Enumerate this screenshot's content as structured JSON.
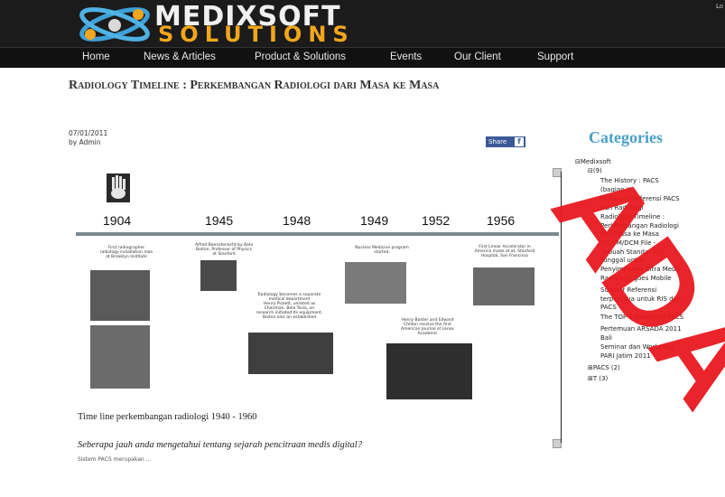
{
  "brand": {
    "name": "MEDIXSOFT",
    "sub": "SOLUTIONS",
    "colors": {
      "accent": "#f2a61b",
      "link": "#4aa0c8",
      "watermark": "#e8191f"
    }
  },
  "header": {
    "login_text": "Lo"
  },
  "nav": [
    "Home",
    "News & Articles",
    "Product & Solutions",
    "Events",
    "Our Client",
    "Support"
  ],
  "post": {
    "title": "Radiology Timeline : Perkembangan Radiologi dari Masa ke Masa",
    "date": "07/01/2011",
    "author": "by Admin",
    "share_label": "Share",
    "timeline_caption": "Time line perkembangan radiologi 1940 - 1960",
    "question": "Seberapa jauh anda mengetahui tentang sejarah pencitraan medis digital?",
    "cut_text": "Sistem PACS merupakan ...",
    "years": [
      "1904",
      "1945",
      "1948",
      "1949",
      "1952",
      "1956"
    ],
    "captions": [
      "First radiographer\nradiology installation man\nat Brooklyn Institute",
      "Alfred Boenstenecht by Bela\nBoiton, Professor of Physics\nat Stanford",
      "Radiology becomes a separate\nmedical department\nHenry Pickett, unlisted as\nChairman. Bela Tesla, on\nresearch initiated its equipment,\nBoiton also an established",
      "Nuclear Medicine program\nstarted.",
      "Henry Baxter and Edward\nChilton receive the first\nAmerican Journal of Lenox\nAcademic",
      "First Linear Accelerator in\nAmerica made at at, Stanford\nHospital, San Francisco"
    ]
  },
  "sidebar": {
    "title": "Categories",
    "tree_root": "Medixsoft",
    "tree_group": "(9)",
    "items": [
      "The History : PACS\n(bagian I)",
      "Rujukan / Referensi PACS\ndan Radiologi",
      "Radiology Timeline :\nPerkembangan Radiologi\ndari Masa ke Masa",
      "DICOM/DCM File -\nSebuah Standar File\nTunggal untuk\nPenyimpanan Citra Medis",
      "Radiology goes Mobile",
      "Sumber Referensi\nterpercaya untuk RIS dan\nPACS",
      "The TOP 3 Benefit of PACS",
      "Pertemuan ARSADA 2011\nBali",
      "Seminar dan Workshop\nPARI Jatim 2011"
    ],
    "other": [
      "PACS (2)",
      "T (3)"
    ]
  },
  "watermark": "ADA"
}
